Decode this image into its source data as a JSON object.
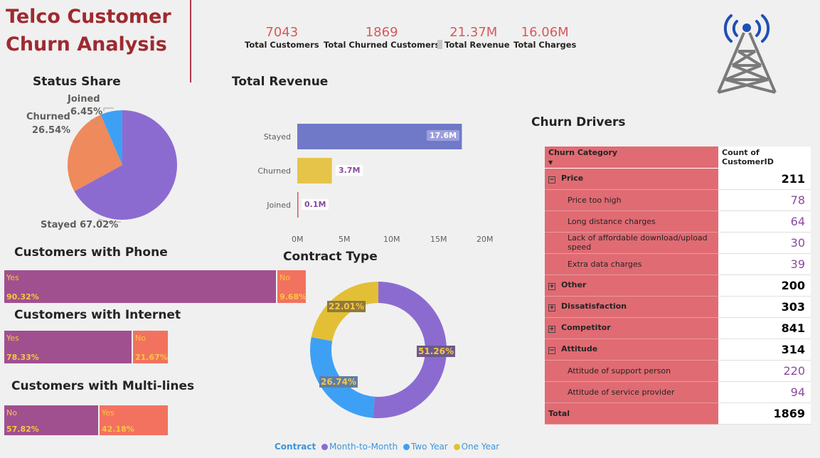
{
  "header": {
    "title_line1": "Telco Customer",
    "title_line2": "Churn Analysis"
  },
  "kpis": [
    {
      "value": "7043",
      "label": "Total Customers"
    },
    {
      "value": "1869",
      "label": "Total Churned Customers"
    },
    {
      "value": "21.37M",
      "label": "Total Revenue"
    },
    {
      "value": "16.06M",
      "label": "Total Charges"
    }
  ],
  "icons": {
    "logo": "cell-tower-icon",
    "expand": "expand-icon",
    "collapse": "collapse-icon",
    "sort": "sort-down-icon"
  },
  "colors": {
    "title": "#9e2a2f",
    "kpi": "#d9585a",
    "stayed": "#8c6bd1",
    "churned": "#ee8a5c",
    "joined": "#3ea0f5",
    "twoYear": "#3ea0f5",
    "oneYear": "#e3bf35",
    "barPurple": "#a0508f",
    "barSalmon": "#f2725f",
    "tableHeader": "#e06b73"
  },
  "chart_data": [
    {
      "type": "pie",
      "title": "Status Share",
      "categories": [
        "Stayed",
        "Churned",
        "Joined"
      ],
      "values": [
        67.02,
        26.54,
        6.45
      ],
      "labels": [
        "Stayed 67.02%",
        "Churned",
        "26.54%",
        "Joined",
        "6.45%"
      ]
    },
    {
      "type": "bar",
      "title": "Total Revenue",
      "orientation": "horizontal",
      "categories": [
        "Stayed",
        "Churned",
        "Joined"
      ],
      "values": [
        17.6,
        3.7,
        0.1
      ],
      "value_labels": [
        "17.6M",
        "3.7M",
        "0.1M"
      ],
      "xlim": [
        0,
        20
      ],
      "ticks": [
        "0M",
        "5M",
        "10M",
        "15M",
        "20M"
      ]
    },
    {
      "type": "pie",
      "subtype": "donut",
      "title": "Contract Type",
      "legend_title": "Contract",
      "categories": [
        "Month-to-Month",
        "Two Year",
        "One Year"
      ],
      "values": [
        51.26,
        26.74,
        22.01
      ],
      "value_labels": [
        "51.26%",
        "26.74%",
        "22.01%"
      ],
      "legend": "bottom"
    },
    {
      "type": "bar",
      "subtype": "100% stacked",
      "title": "Customers with Phone",
      "categories": [
        "Yes",
        "No"
      ],
      "values": [
        90.32,
        9.68
      ],
      "value_labels": [
        "90.32%",
        "9.68%"
      ]
    },
    {
      "type": "bar",
      "subtype": "100% stacked",
      "title": "Customers with Internet",
      "categories": [
        "Yes",
        "No"
      ],
      "values": [
        78.33,
        21.67
      ],
      "value_labels": [
        "78.33%",
        "21.67%"
      ]
    },
    {
      "type": "bar",
      "subtype": "100% stacked",
      "title": "Customers with Multi-lines",
      "categories": [
        "No",
        "Yes"
      ],
      "values": [
        57.82,
        42.18
      ],
      "value_labels": [
        "57.82%",
        "42.18%"
      ]
    },
    {
      "type": "table",
      "title": "Churn Drivers",
      "columns": [
        "Churn Category",
        "Count of CustomerID"
      ],
      "rows": [
        {
          "label": "Price",
          "value": "211",
          "level": 1,
          "expanded": true
        },
        {
          "label": "Price too high",
          "value": "78",
          "level": 2
        },
        {
          "label": "Long distance charges",
          "value": "64",
          "level": 2
        },
        {
          "label": "Lack of affordable download/upload speed",
          "value": "30",
          "level": 2
        },
        {
          "label": "Extra data charges",
          "value": "39",
          "level": 2
        },
        {
          "label": "Other",
          "value": "200",
          "level": 1,
          "expanded": false
        },
        {
          "label": "Dissatisfaction",
          "value": "303",
          "level": 1,
          "expanded": false
        },
        {
          "label": "Competitor",
          "value": "841",
          "level": 1,
          "expanded": false
        },
        {
          "label": "Attitude",
          "value": "314",
          "level": 1,
          "expanded": true
        },
        {
          "label": "Attitude of support person",
          "value": "220",
          "level": 2
        },
        {
          "label": "Attitude of service provider",
          "value": "94",
          "level": 2
        },
        {
          "label": "Total",
          "value": "1869",
          "level": 0
        }
      ]
    }
  ]
}
